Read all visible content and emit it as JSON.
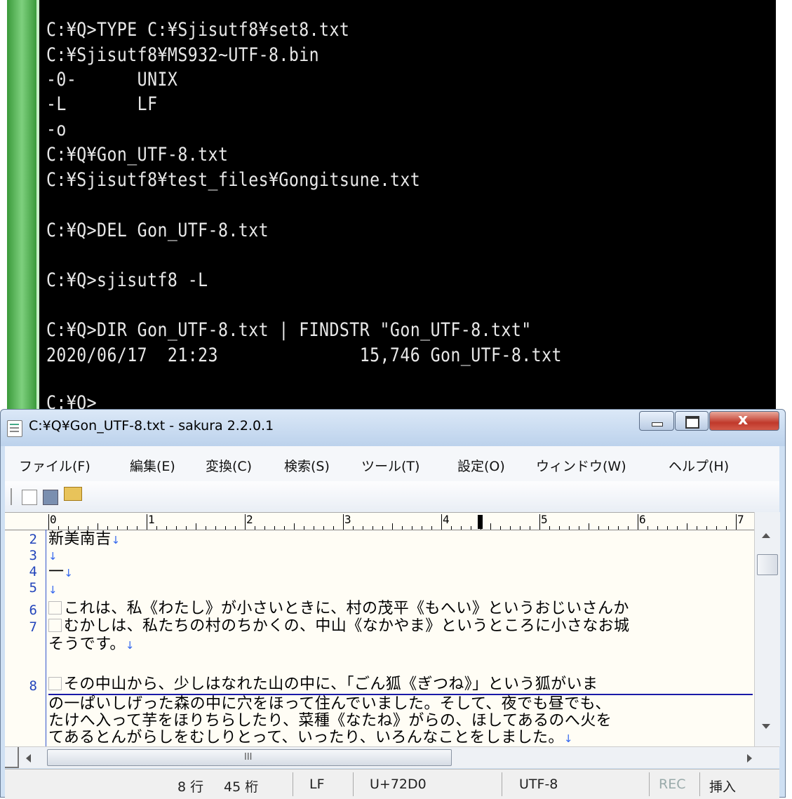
{
  "console": {
    "lines": [
      "C:¥Q>TYPE C:¥Sjisutf8¥set8.txt",
      "C:¥Sjisutf8¥MS932~UTF-8.bin",
      "-0-      UNIX",
      "-L       LF",
      "-o",
      "C:¥Q¥Gon_UTF-8.txt",
      "C:¥Sjisutf8¥test_files¥Gongitsune.txt",
      "C:¥Q>DEL Gon_UTF-8.txt",
      "C:¥Q>sjisutf8 -L",
      "C:¥Q>DIR Gon_UTF-8.txt | FINDSTR \"Gon_UTF-8.txt\"",
      "2020/06/17  21:23              15,746 Gon_UTF-8.txt",
      "C:¥Q>"
    ]
  },
  "window": {
    "title": "C:¥Q¥Gon_UTF-8.txt - sakura 2.2.0.1",
    "close_glyph": "x"
  },
  "menu": [
    "ファイル(F)",
    "編集(E)",
    "変換(C)",
    "検索(S)",
    "ツール(T)",
    "設定(O)",
    "ウィンドウ(W)",
    "ヘルプ(H)"
  ],
  "ruler": [
    "0",
    "1",
    "2",
    "3",
    "4",
    "5",
    "6",
    "7"
  ],
  "editor": {
    "line_numbers": [
      "2",
      "3",
      "4",
      "5",
      "6",
      "7",
      "8"
    ],
    "lines": [
      {
        "text": "新美南吉",
        "eol": "↓"
      },
      {
        "text": "",
        "eol": "↓"
      },
      {
        "text": "一",
        "eol": "↓"
      },
      {
        "text": "",
        "eol": "↓"
      },
      {
        "text": "これは、私《わたし》が小さいときに、村の茂平《もへい》というおじいさんか",
        "eol": ""
      },
      {
        "text": "むかしは、私たちの村のちかくの、中山《なかやま》というところに小さなお城",
        "eol": ""
      },
      {
        "text": "そうです。",
        "eol": "↓"
      },
      {
        "text": "その中山から、少しはなれた山の中に、「ごん狐《ぎつね》」という狐がいま",
        "eol": ""
      },
      {
        "text": "の一ぱいしげった森の中に穴をほって住んでいました。そして、夜でも昼でも、",
        "eol": ""
      },
      {
        "text": "たけへ入って芋をほりちらしたり、菜種《なたね》がらの、ほしてあるのへ火を",
        "eol": ""
      },
      {
        "text": "てあるとんがらしをむしりとって、いったり、いろんなことをしました。",
        "eol": "↓"
      }
    ]
  },
  "hscroll_grip": "III",
  "status": {
    "line": "8 行",
    "col": "45 桁",
    "eol_mode": "LF",
    "codepoint": "U+72D0",
    "encoding": "UTF-8",
    "rec": "REC",
    "insert": "挿入"
  }
}
